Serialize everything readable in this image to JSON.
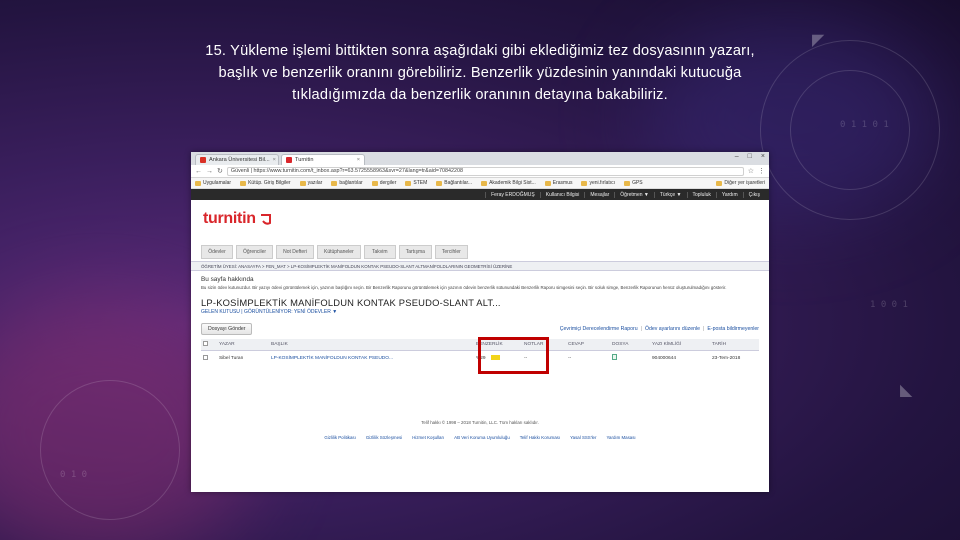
{
  "caption": {
    "line1": "15. Yükleme işlemi bittikten sonra aşağıdaki gibi eklediğimiz tez dosyasının yazarı,",
    "line2": "başlık ve benzerlik oranını görebiliriz. Benzerlik yüzdesinin yanındaki kutucuğa",
    "line3": "tıkladığımızda da benzerlik oranının detayına bakabiliriz."
  },
  "browser": {
    "tabs": [
      {
        "label": "Ankara Üniversitesi Bil...",
        "color": "#d93025"
      },
      {
        "label": "Turnitin",
        "color": "#d9262b"
      }
    ],
    "url": "Güvenli | https://www.turnitin.com/t_inbox.asp?r=63.5725558963&svr=27&lang=tr&aid=70842208",
    "bookmarks": [
      "Uygulamalar",
      "Kütüp. Giriş Bilgiler",
      "yazılar",
      "bağlantılar",
      "dergiler",
      "STEM",
      "Bağlantılar...",
      "Akademik Bilgi Sist...",
      "Erasmus",
      "yeni.fırlatıcı",
      "GPS",
      "Diğer yer işaretleri"
    ],
    "userbar": [
      "Feray ERDOĞMUŞ",
      "Kullanıcı Bilgisi",
      "Mesajlar",
      "Öğretmen ▼",
      "Türkçe ▼",
      "Topluluk",
      "Yardım",
      "Çıkış"
    ]
  },
  "turnitin": {
    "logo": "turnitin",
    "nav_tabs": [
      "Ödevler",
      "Öğrenciler",
      "Not Defteri",
      "Kütüphaneler",
      "Takvim",
      "Tartışma",
      "Tercihler"
    ],
    "breadcrumb": "ÖĞRETİM ÜYESİ: ANASAYFA > FEN_MAT > LP-KOSİMPLEKTİK MANİFOLDUN KONTAK PSEUDO-SLANT ALTMANİFOLDLARININ GEOMETRİSİ ÜZERİNE",
    "about_title": "Bu sayfa hakkında",
    "about_text": "Bu sizin ödev kutunuzdur. Bir yazıyı ödevi görüntülemek için, yazının başlığını seçin. Bir Benzerlik Raporunu görüntülemek için yazının ödevin benzerlik sütunundaki Benzerlik Raporu simgesini seçin. Bir soluk simge, Benzerlik Raporunun henüz oluşturulmadığını gösterir.",
    "paper_title": "LP-KOSİMPLEKTİK MANİFOLDUN KONTAK PSEUDO-SLANT ALT...",
    "subtitle": "GELEN KUTUSU | GÖRÜNTÜLENİYOR: YENİ ÖDEVLER ▼",
    "upload_button": "Dosyayı Gönder",
    "links": [
      "Çevrimiçi Derecelendirme Raporu",
      "Ödev ayarlarını düzenle",
      "E-posta bildirmeyenler"
    ],
    "table": {
      "headers": [
        "",
        "YAZAR",
        "BAŞLIK",
        "BENZERLİK",
        "NOTLAR",
        "CEVAP",
        "DOSYA",
        "YAZI KİMLİĞİ",
        "TARİH"
      ],
      "rows": [
        {
          "author": "Sibel Turan",
          "title": "LP-KOSİMPLEKTİK MANİFOLDUN KONTAK PSEUDO...",
          "similarity": "%29",
          "grade": "--",
          "response": "--",
          "paper_id": "904000644",
          "date": "23-Tem-2018"
        }
      ]
    },
    "copyright": "Telif hakkı © 1998 – 2018 Turnitin, LLC. Tüm hakları saklıdır.",
    "footer_links": [
      "Gizlilik Politikası",
      "Gizlilik Sözleşmesi",
      "Hizmet Koşulları",
      "AB Veri Koruma Uyumluluğu",
      "Telif Hakkı Koruması",
      "Yasal SSS'ler",
      "Yardım Masası"
    ]
  },
  "colors": {
    "highlight": "#c00000",
    "turnitin_red": "#d9262b",
    "similarity_bar": "#f2d41a"
  }
}
